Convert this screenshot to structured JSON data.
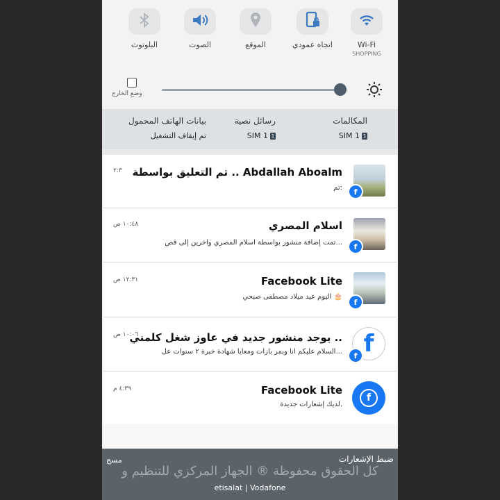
{
  "quick_settings": {
    "toggles": [
      {
        "label": "Wi-Fi",
        "sub": "SHOPPING",
        "icon": "wifi-icon"
      },
      {
        "label": "اتجاه عمودي",
        "sub": "",
        "icon": "portrait-lock-icon"
      },
      {
        "label": "الموقع",
        "sub": "",
        "icon": "location-icon"
      },
      {
        "label": "الصوت",
        "sub": "",
        "icon": "sound-icon"
      },
      {
        "label": "البلوتوث",
        "sub": "",
        "icon": "bluetooth-icon"
      }
    ],
    "brightness": {
      "level": 0.98,
      "auto_label": "وضع الخارج"
    }
  },
  "sim_bar": {
    "calls": {
      "title": "المكالمات",
      "sim": "SIM 1"
    },
    "messages": {
      "title": "رسائل نصية",
      "sim": "SIM 1"
    },
    "data": {
      "title": "بيانات الهاتف المحمول",
      "status": "تم إيقاف التشغيل"
    }
  },
  "notifications": [
    {
      "title": "تم التعليق بواسطة .. Abdallah Aboalm",
      "body": "تم:",
      "time": "٢:٣",
      "avatar": "photo1"
    },
    {
      "title": "اسلام المصري",
      "body": "تمت إضافة منشور بواسطة اسلام المصري وآخرين إلى قص...",
      "time": "١٠:٤٨ ص",
      "avatar": "photo2"
    },
    {
      "title": "Facebook Lite",
      "body": "اليوم عيد ميلاد مصطفى صبحي 🎂",
      "time": "١٢:٣١ ص",
      "avatar": "photo3"
    },
    {
      "title": "يوجد منشور جديد في عاوز شغل كلمني ..",
      "body": "السلام عليكم انا وبمر بازات ومعايا شهادة خبرة ٢ سنوات عل...",
      "time": "١٠:٠٦ ص",
      "avatar": "facebook-logo"
    },
    {
      "title": "Facebook Lite",
      "body": "لديك إشعارات جديدة.",
      "time": "٤:٣٩ م",
      "avatar": "facebook-blue"
    }
  ],
  "footer": {
    "settings_label": "ضبط الإشعارات",
    "clear_label": "مسح",
    "carrier": "etisalat | Vodafone",
    "watermark": "كل الحقوق محفوظة ® الجهاز المركزي للتنظيم و"
  },
  "colors": {
    "accent": "#1877f2",
    "bottom_bar": "#5b6369",
    "sim_bar": "#dde1e4"
  }
}
